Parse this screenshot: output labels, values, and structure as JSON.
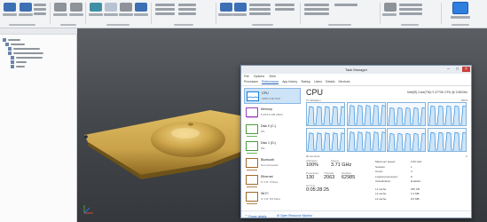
{
  "task_manager": {
    "title": "Task Manager",
    "menu": [
      "File",
      "Options",
      "View"
    ],
    "tabs": [
      "Processes",
      "Performance",
      "App history",
      "Startup",
      "Users",
      "Details",
      "Services"
    ],
    "active_tab": 1,
    "perf_items": [
      {
        "name": "CPU",
        "detail": "100% 3.50 GHz",
        "color": "#1c7fd6"
      },
      {
        "name": "Memory",
        "detail": "5.2/15.9 GB (33%)",
        "color": "#9b3fbf"
      },
      {
        "name": "Disk 0 (C:)",
        "detail": "0%",
        "color": "#4aa03a"
      },
      {
        "name": "Disk 1 (D:)",
        "detail": "0%",
        "color": "#4aa03a"
      },
      {
        "name": "Bluetooth",
        "detail": "Not connected",
        "color": "#a36a2a"
      },
      {
        "name": "Ethernet",
        "detail": "S: 0 R: 0 Kbps",
        "color": "#a36a2a"
      },
      {
        "name": "Wi-Fi",
        "detail": "S: 0 R: 8.0 Kbps",
        "color": "#a36a2a"
      }
    ],
    "cpu": {
      "title": "CPU",
      "model": "Intel(R) Core(TM) i7-4770K CPU @ 3.50GHz",
      "util_label": "% Utilization",
      "pct_max": "100%",
      "time_label": "60 seconds",
      "zero": "0",
      "core_levels": [
        0.85,
        0.9,
        0.8,
        0.88,
        0.82,
        0.86,
        0.8,
        0.84
      ],
      "stats": [
        {
          "label": "Utilization",
          "value": "100%"
        },
        {
          "label": "Speed",
          "value": "3.71 GHz"
        },
        {
          "label": "Processes",
          "value": "130"
        },
        {
          "label": "Threads",
          "value": "2063"
        },
        {
          "label": "Handles",
          "value": "62985"
        },
        {
          "label": "Up time",
          "value": "0:05:28:25"
        }
      ],
      "kv": [
        {
          "k": "Maximum speed:",
          "v": "3.50 GHz"
        },
        {
          "k": "Sockets:",
          "v": "1"
        },
        {
          "k": "Cores:",
          "v": "4"
        },
        {
          "k": "Logical processors:",
          "v": "8"
        },
        {
          "k": "Virtualization:",
          "v": "Enabled"
        },
        {
          "k": "L1 cache:",
          "v": "256 KB"
        },
        {
          "k": "L2 cache:",
          "v": "1.0 MB"
        },
        {
          "k": "L3 cache:",
          "v": "8.0 MB"
        }
      ]
    },
    "footer": {
      "fewer": "Fewer details",
      "open": "Open Resource Monitor"
    }
  },
  "colors": {
    "part_gold": "#c9a24a",
    "cpu_line": "#1c7fd6",
    "ribbon_bg": "#f2f3f5"
  }
}
